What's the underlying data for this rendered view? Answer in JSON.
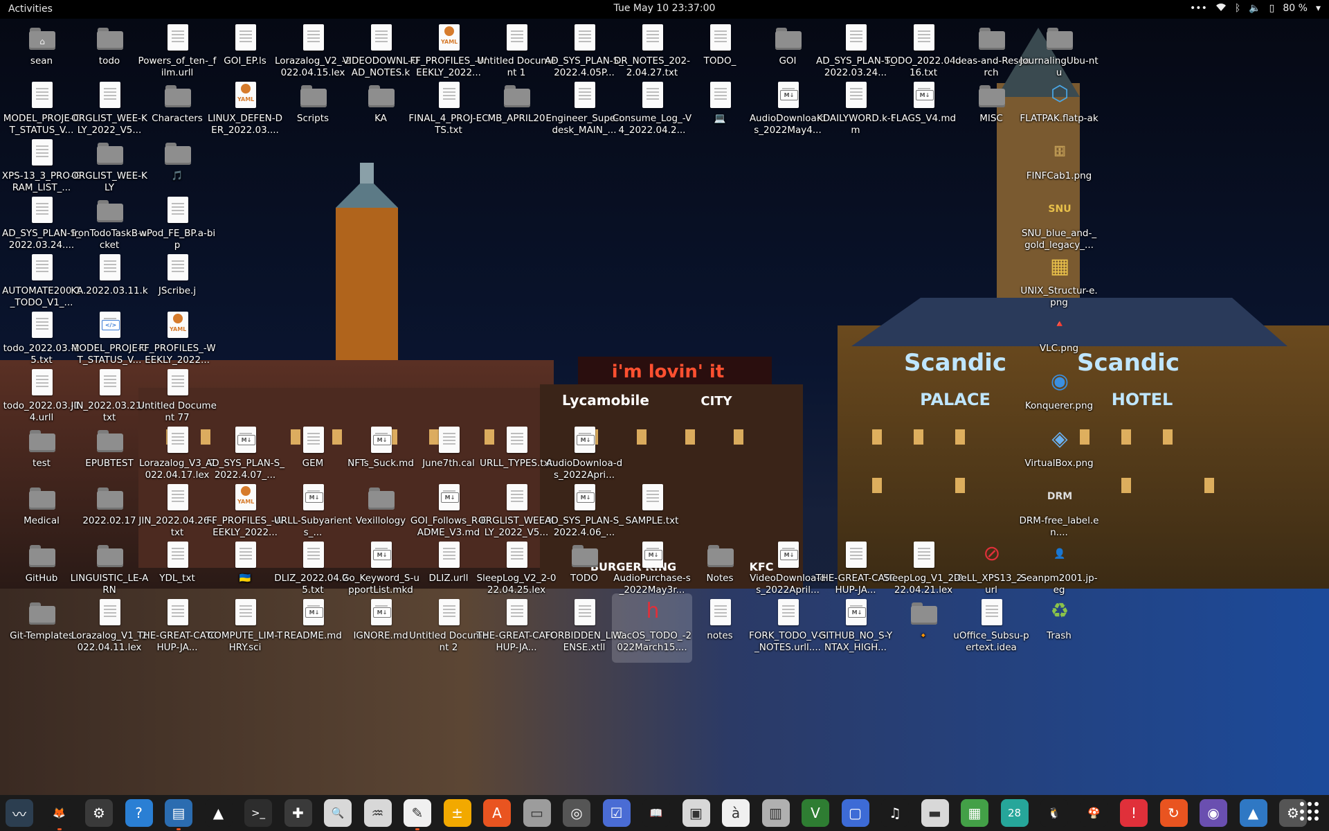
{
  "topbar": {
    "activities": "Activities",
    "clock": "Tue May 10  23:37:00",
    "tray": {
      "menu": "•••",
      "battery_pct": "80 %"
    }
  },
  "wallpaper": {
    "signs": {
      "mcd": "i'm lovin' it",
      "lycamobile": "Lycamobile",
      "city": "CITY",
      "scandic_left": "Scandic",
      "palace": "PALACE",
      "scandic_right": "Scandic",
      "hotel": "HOTEL",
      "burger": "BURGER KING",
      "kfc": "KFC"
    }
  },
  "desktop_icons": [
    {
      "label": "sean",
      "kind": "folder",
      "mark": "⌂"
    },
    {
      "label": "todo",
      "kind": "folder"
    },
    {
      "label": "Powers_of_ten-_film.urll",
      "kind": "doc"
    },
    {
      "label": "GOI_EP.ls",
      "kind": "doc"
    },
    {
      "label": "Lorazalog_V2_-2022.04.15.lex",
      "kind": "doc"
    },
    {
      "label": "VIDEODOWNL-OAD_NOTES.k",
      "kind": "doc"
    },
    {
      "label": "FF_PROFILES_-WEEKLY_2022...",
      "kind": "yaml"
    },
    {
      "label": "Untitled Document 1",
      "kind": "doc"
    },
    {
      "label": "AD_SYS_PLAN-S_2022.4.05P...",
      "kind": "doc"
    },
    {
      "label": "DR_NOTES_202-2.04.27.txt",
      "kind": "doc"
    },
    {
      "label": "TODO_",
      "kind": "doc"
    },
    {
      "label": "GOI",
      "kind": "folder"
    },
    {
      "label": "AD_SYS_PLAN-S_2022.03.24...",
      "kind": "doc"
    },
    {
      "label": "TODO_2022.04.-16.txt",
      "kind": "doc"
    },
    {
      "label": "Ideas-and-Research",
      "kind": "folder"
    },
    {
      "label": "JournalingUbu-ntu",
      "kind": "folder"
    },
    {
      "label": "MODEL_PROJE-CT_STATUS_V...",
      "kind": "doc"
    },
    {
      "label": "ORGLIST_WEE-KLY_2022_V5...",
      "kind": "doc"
    },
    {
      "label": "Characters",
      "kind": "folder"
    },
    {
      "label": "LINUX_DEFEN-DER_2022.03....",
      "kind": "yaml"
    },
    {
      "label": "Scripts",
      "kind": "folder"
    },
    {
      "label": "KA",
      "kind": "folder"
    },
    {
      "label": "FINAL_4_PROJ-ECTS.txt",
      "kind": "doc"
    },
    {
      "label": "MB_APRIL20",
      "kind": "folder"
    },
    {
      "label": "Engineer_Supe-rdesk_MAIN_...",
      "kind": "doc"
    },
    {
      "label": "Consume_Log_-V4_2022.04.2...",
      "kind": "doc"
    },
    {
      "label": "💻",
      "kind": "doc"
    },
    {
      "label": "AudioDownloa-ds_2022May4...",
      "kind": "md"
    },
    {
      "label": "KDAILYWORD.k-tm",
      "kind": "doc"
    },
    {
      "label": "FLAGS_V4.md",
      "kind": "md"
    },
    {
      "label": "MISC",
      "kind": "folder"
    },
    {
      "label": "FLATPAK.flatp-ak",
      "kind": "special",
      "glyph": "⬡",
      "color": "#4aa8e8"
    },
    {
      "label": "XPS-13_3_PRO-GRAM_LIST_...",
      "kind": "doc"
    },
    {
      "label": "ORGLIST_WEE-KLY",
      "kind": "folder"
    },
    {
      "label": "🎵",
      "kind": "folder"
    },
    {
      "label": "FINFCab1.png",
      "kind": "special",
      "glyph": "🗄",
      "color": "#c9a45a"
    },
    {
      "label": "AD_SYS_PLAN-S_2022.03.24....",
      "kind": "doc"
    },
    {
      "label": "IronTodoTaskB-ucket",
      "kind": "folder"
    },
    {
      "label": "wPod_FE_BP.a-bip",
      "kind": "doc"
    },
    {
      "label": "SNU_blue_and-_gold_legacy_...",
      "kind": "special",
      "glyph": "SNU",
      "color": "#e8c04a"
    },
    {
      "label": "AUTOMATE200-1_TODO_V1_...",
      "kind": "doc"
    },
    {
      "label": "KA.2022.03.11.k",
      "kind": "doc"
    },
    {
      "label": "JScribe.j",
      "kind": "doc"
    },
    {
      "label": "UNIX_Structur-e.png",
      "kind": "special",
      "glyph": "▦",
      "color": "#e8c04a"
    },
    {
      "label": "todo_2022.03.-25.txt",
      "kind": "doc"
    },
    {
      "label": "MODEL_PROJE-CT_STATUS_V...",
      "kind": "code"
    },
    {
      "label": "FF_PROFILES_-WEEKLY_2022...",
      "kind": "yaml"
    },
    {
      "label": "VLC.png",
      "kind": "special",
      "glyph": "🔺",
      "color": "#f08a1c"
    },
    {
      "label": "todo_2022.03.-14.urll",
      "kind": "doc"
    },
    {
      "label": "JIN_2022.03.21-.txt",
      "kind": "doc"
    },
    {
      "label": "Untitled Document 77",
      "kind": "doc"
    },
    {
      "label": "Konquerer.png",
      "kind": "special",
      "glyph": "◉",
      "color": "#3b8fe0"
    },
    {
      "label": "test",
      "kind": "folder"
    },
    {
      "label": "EPUBTEST",
      "kind": "folder"
    },
    {
      "label": "Lorazalog_V3_-2022.04.17.lex",
      "kind": "doc"
    },
    {
      "label": "AD_SYS_PLAN-S_2022.4.07_...",
      "kind": "md"
    },
    {
      "label": "GEM",
      "kind": "doc"
    },
    {
      "label": "NFTs_Suck.md",
      "kind": "md"
    },
    {
      "label": "June7th.cal",
      "kind": "doc"
    },
    {
      "label": "URLL_TYPES.txt",
      "kind": "doc"
    },
    {
      "label": "AudioDownloa-ds_2022Apri...",
      "kind": "md"
    },
    {
      "label": "VirtualBox.png",
      "kind": "special",
      "glyph": "◈",
      "color": "#6ab0f0"
    },
    {
      "label": "Medical",
      "kind": "folder"
    },
    {
      "label": "2022.02.17",
      "kind": "folder"
    },
    {
      "label": "JIN_2022.04.26-.txt",
      "kind": "doc"
    },
    {
      "label": "FF_PROFILES_-WEEKLY_2022...",
      "kind": "yaml"
    },
    {
      "label": "URLL-Subyarients_...",
      "kind": "md"
    },
    {
      "label": "Vexillology",
      "kind": "folder"
    },
    {
      "label": "GOI_Follows_R-EADME_V3.md",
      "kind": "md"
    },
    {
      "label": "ORGLIST_WEE-KLY_2022_V5...",
      "kind": "doc"
    },
    {
      "label": "AD_SYS_PLAN-S_2022.4.06_...",
      "kind": "md"
    },
    {
      "label": "SAMPLE.txt",
      "kind": "doc"
    },
    {
      "label": "DRM-free_label.en....",
      "kind": "special",
      "glyph": "DRM",
      "color": "#dddddd"
    },
    {
      "label": "GitHub",
      "kind": "folder"
    },
    {
      "label": "LINGUISTIC_LE-ARN",
      "kind": "folder"
    },
    {
      "label": "YDL_txt",
      "kind": "doc"
    },
    {
      "label": "🇺🇦",
      "kind": "doc"
    },
    {
      "label": "DLIZ_2022.04.2-5.txt",
      "kind": "doc"
    },
    {
      "label": "Go_Keyword_S-upportList.mkd",
      "kind": "md"
    },
    {
      "label": "DLIZ.urll",
      "kind": "doc"
    },
    {
      "label": "SleepLog_V2_2-022.04.25.lex",
      "kind": "doc"
    },
    {
      "label": "TODO",
      "kind": "folder"
    },
    {
      "label": "AudioPurchase-s_2022May3r...",
      "kind": "md"
    },
    {
      "label": "Notes",
      "kind": "folder"
    },
    {
      "label": "VideoDownloa-ds_2022April...",
      "kind": "md"
    },
    {
      "label": "THE-GREAT-CATCHUP-JA...",
      "kind": "doc"
    },
    {
      "label": "SleepLog_V1_2-022.04.21.lex",
      "kind": "doc"
    },
    {
      "label": "DeLL_XPS13_2.-url",
      "kind": "special",
      "glyph": "⊘",
      "color": "#e0303a"
    },
    {
      "label": "Seanpm2001.jp-eg",
      "kind": "special",
      "glyph": "👤",
      "color": "#ccc"
    },
    {
      "label": "Git-Templates",
      "kind": "folder"
    },
    {
      "label": "Lorazalog_V1_-2022.04.11.lex",
      "kind": "doc"
    },
    {
      "label": "THE-GREAT-CATCHUP-JA...",
      "kind": "doc"
    },
    {
      "label": "COMPUTE_LIM-THRY.sci",
      "kind": "doc"
    },
    {
      "label": "README.md",
      "kind": "md"
    },
    {
      "label": "IGNORE.md",
      "kind": "md"
    },
    {
      "label": "Untitled Document 2",
      "kind": "doc"
    },
    {
      "label": "THE-GREAT-CATCHUP-JA...",
      "kind": "doc"
    },
    {
      "label": "FORBIDDEN_LI-CENSE.xtll",
      "kind": "doc"
    },
    {
      "label": "WacOS_TODO_-2022March15....",
      "kind": "special",
      "glyph": "h",
      "color": "#e0303a"
    },
    {
      "label": "notes",
      "kind": "doc"
    },
    {
      "label": "FORK_TODO_V-5_NOTES.urll....",
      "kind": "doc"
    },
    {
      "label": "GITHUB_NO_S-YNTAX_HIGH...",
      "kind": "md"
    },
    {
      "label": "🔸",
      "kind": "folder"
    },
    {
      "label": "uOffice_Subsu-pertext.idea",
      "kind": "doc"
    },
    {
      "label": "Trash",
      "kind": "special",
      "glyph": "♻",
      "color": "#8bc34a"
    }
  ],
  "dock": [
    {
      "name": "system-monitor",
      "glyph": "〰",
      "bg": "#2c3e50",
      "run": false
    },
    {
      "name": "firefox",
      "glyph": "🦊",
      "bg": "#1b1b1b",
      "run": true
    },
    {
      "name": "settings",
      "glyph": "⚙",
      "bg": "#3a3a3a",
      "run": false
    },
    {
      "name": "help",
      "glyph": "?",
      "bg": "#2a7fd4",
      "run": false
    },
    {
      "name": "writer",
      "glyph": "▤",
      "bg": "#2b6cb0",
      "run": true
    },
    {
      "name": "vlc",
      "glyph": "▲",
      "bg": "#1b1b1b",
      "run": false
    },
    {
      "name": "terminal",
      "glyph": ">_",
      "bg": "#2d2d2d",
      "run": false
    },
    {
      "name": "add-app",
      "glyph": "✚",
      "bg": "#3a3a3a",
      "run": false
    },
    {
      "name": "search",
      "glyph": "🔍",
      "bg": "#d8d8d8",
      "run": false
    },
    {
      "name": "monitor",
      "glyph": "♒",
      "bg": "#d8d8d8",
      "run": false
    },
    {
      "name": "text-editor",
      "glyph": "✎",
      "bg": "#f0f0f0",
      "run": true
    },
    {
      "name": "calculator",
      "glyph": "±",
      "bg": "#f2a900",
      "run": false
    },
    {
      "name": "software",
      "glyph": "A",
      "bg": "#e95420",
      "run": false
    },
    {
      "name": "files",
      "glyph": "▭",
      "bg": "#9c9c9c",
      "run": false
    },
    {
      "name": "disks",
      "glyph": "◎",
      "bg": "#555",
      "run": false
    },
    {
      "name": "tasks",
      "glyph": "☑",
      "bg": "#4a6cd4",
      "run": false
    },
    {
      "name": "reader",
      "glyph": "📖",
      "bg": "#1b1b1b",
      "run": false
    },
    {
      "name": "document-scanner",
      "glyph": "▣",
      "bg": "#d8d8d8",
      "run": false
    },
    {
      "name": "character-map",
      "glyph": "à",
      "bg": "#f0f0f0",
      "run": false
    },
    {
      "name": "archive",
      "glyph": "▥",
      "bg": "#b0b0b0",
      "run": false
    },
    {
      "name": "vim",
      "glyph": "V",
      "bg": "#2e7d32",
      "run": false
    },
    {
      "name": "boxes",
      "glyph": "▢",
      "bg": "#3d6bd6",
      "run": false
    },
    {
      "name": "music",
      "glyph": "♫",
      "bg": "#1b1b1b",
      "run": false
    },
    {
      "name": "pdf",
      "glyph": "▬",
      "bg": "#d8d8d8",
      "run": false
    },
    {
      "name": "calc",
      "glyph": "▦",
      "bg": "#43a047",
      "run": false
    },
    {
      "name": "calendar",
      "glyph": "28",
      "bg": "#26a69a",
      "run": false
    },
    {
      "name": "penguin",
      "glyph": "🐧",
      "bg": "#1b1b1b",
      "run": false
    },
    {
      "name": "game",
      "glyph": "🍄",
      "bg": "#1b1b1b",
      "run": false
    },
    {
      "name": "alert",
      "glyph": "!",
      "bg": "#e0303a",
      "run": false
    },
    {
      "name": "updates",
      "glyph": "↻",
      "bg": "#e95420",
      "run": false
    },
    {
      "name": "screenshot",
      "glyph": "◉",
      "bg": "#6a4fb0",
      "run": false
    },
    {
      "name": "photos",
      "glyph": "▲",
      "bg": "#2f78c4",
      "run": false
    },
    {
      "name": "tweaks",
      "glyph": "⚙",
      "bg": "#555",
      "run": false
    }
  ]
}
